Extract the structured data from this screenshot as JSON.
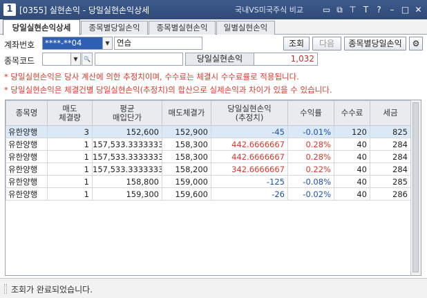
{
  "window": {
    "number": "1",
    "title": "[0355]  실현손익 - 당일실현손익상세",
    "link": "국내VS미국주식 비교",
    "icons": [
      "window-list-icon",
      "cascade-icon",
      "pin-icon",
      "font-size-icon",
      "help-icon",
      "minimize-icon",
      "maximize-icon",
      "close-icon"
    ]
  },
  "tabs": [
    "당일실현손익상세",
    "종목별당일손익",
    "종목별실현손익",
    "일별실현손익"
  ],
  "form": {
    "account_label": "계좌번호",
    "account_value": "****-**04",
    "account_name": "연습",
    "stock_label": "종목코드",
    "stock_value": "",
    "stock_name": "",
    "search_button": "조회",
    "next_button": "다음",
    "by_stock_button": "종목별당일손익",
    "daily_pl_label": "당일실현손익",
    "daily_pl_value": "1,032"
  },
  "notes": [
    "* 당일실현손익은 당사 계산에 의한 추정치이며, 수수료는 체결시 수수료률로 적용됩니다.",
    "* 당일실현손익은 체결건별 당일실현손익(추정치)의 합산으로 실제손익과 차이가 있을 수 있습니다."
  ],
  "table": {
    "headers": [
      [
        "종목명"
      ],
      [
        "매도",
        "체결량"
      ],
      [
        "평균",
        "매입단가"
      ],
      [
        "매도체결가"
      ],
      [
        "당일실현손익",
        "(추정치)"
      ],
      [
        "수익률"
      ],
      [
        "수수료"
      ],
      [
        "세금"
      ]
    ],
    "rows": [
      {
        "name": "유한양행",
        "qty": "3",
        "avg": "152,600",
        "sell": "152,900",
        "pl": "-45",
        "rate": "-0.01%",
        "fee": "120",
        "tax": "825",
        "sign": "neg",
        "selected": true
      },
      {
        "name": "유한양행",
        "qty": "1",
        "avg": "157,533.3333333",
        "sell": "158,300",
        "pl": "442.6666667",
        "rate": "0.28%",
        "fee": "40",
        "tax": "284",
        "sign": "pos",
        "selected": false
      },
      {
        "name": "유한양행",
        "qty": "1",
        "avg": "157,533.3333333",
        "sell": "158,300",
        "pl": "442.6666667",
        "rate": "0.28%",
        "fee": "40",
        "tax": "284",
        "sign": "pos",
        "selected": false
      },
      {
        "name": "유한양행",
        "qty": "1",
        "avg": "157,533.3333333",
        "sell": "158,200",
        "pl": "342.6666667",
        "rate": "0.22%",
        "fee": "40",
        "tax": "284",
        "sign": "pos",
        "selected": false
      },
      {
        "name": "유한양행",
        "qty": "1",
        "avg": "158,800",
        "sell": "159,000",
        "pl": "-125",
        "rate": "-0.08%",
        "fee": "40",
        "tax": "285",
        "sign": "neg",
        "selected": false
      },
      {
        "name": "유한양행",
        "qty": "1",
        "avg": "159,300",
        "sell": "159,600",
        "pl": "-26",
        "rate": "-0.02%",
        "fee": "40",
        "tax": "286",
        "sign": "neg",
        "selected": false
      }
    ]
  },
  "status": "조회가 완료되었습니다."
}
